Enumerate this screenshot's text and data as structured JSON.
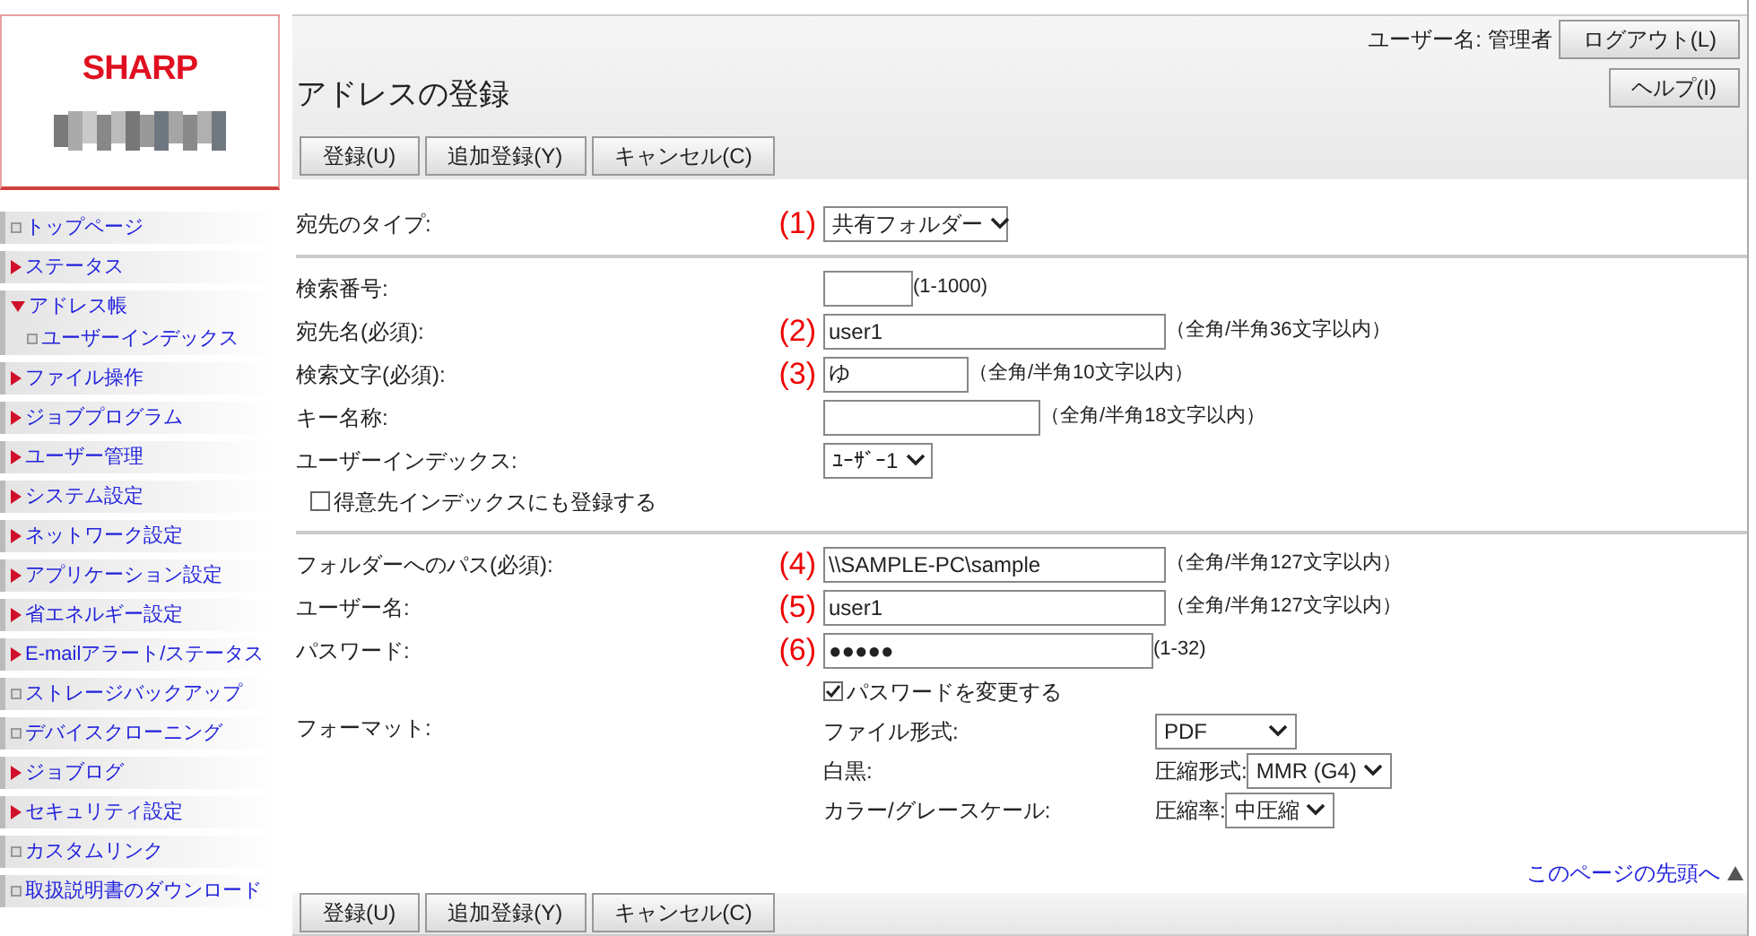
{
  "logo": {
    "brand": "SHARP"
  },
  "header": {
    "user_label": "ユーザー名: 管理者",
    "buttons": [
      "ログアウト(L)",
      "ヘルプ(I)"
    ],
    "title": "アドレスの登録"
  },
  "action_buttons": [
    "登録(U)",
    "追加登録(Y)",
    "キャンセル(C)"
  ],
  "sidebar": {
    "items": [
      {
        "label": "トップページ",
        "kind": "page"
      },
      {
        "label": "ステータス",
        "kind": "section",
        "expanded": false
      },
      {
        "label": "アドレス帳",
        "kind": "section",
        "expanded": true,
        "children": [
          {
            "label": "ユーザーインデックス",
            "kind": "page"
          }
        ]
      },
      {
        "label": "ファイル操作",
        "kind": "section",
        "expanded": false
      },
      {
        "label": "ジョブプログラム",
        "kind": "section",
        "expanded": false
      },
      {
        "label": "ユーザー管理",
        "kind": "section",
        "expanded": false
      },
      {
        "label": "システム設定",
        "kind": "section",
        "expanded": false
      },
      {
        "label": "ネットワーク設定",
        "kind": "section",
        "expanded": false
      },
      {
        "label": "アプリケーション設定",
        "kind": "section",
        "expanded": false
      },
      {
        "label": "省エネルギー設定",
        "kind": "section",
        "expanded": false
      },
      {
        "label": "E-mailアラート/ステータス",
        "kind": "section",
        "expanded": false
      },
      {
        "label": "ストレージバックアップ",
        "kind": "page"
      },
      {
        "label": "デバイスクローニング",
        "kind": "page"
      },
      {
        "label": "ジョブログ",
        "kind": "section",
        "expanded": false
      },
      {
        "label": "セキュリティ設定",
        "kind": "section",
        "expanded": false
      },
      {
        "label": "カスタムリンク",
        "kind": "page"
      },
      {
        "label": "取扱説明書のダウンロード",
        "kind": "page"
      }
    ]
  },
  "form": {
    "sections": [
      {
        "rows": [
          {
            "kind": "select",
            "label": "宛先のタイプ:",
            "marker": "(1)",
            "value": "共有フォルダー"
          }
        ]
      },
      {
        "rows": [
          {
            "kind": "text",
            "label": "検索番号:",
            "hint": "(1-1000)"
          },
          {
            "kind": "text",
            "label": "宛先名(必須):",
            "marker": "(2)",
            "value": "user1",
            "hint": "（全角/半角36文字以内）"
          },
          {
            "kind": "text",
            "label": "検索文字(必須):",
            "marker": "(3)",
            "value": "ゆ",
            "hint": "（全角/半角10文字以内）"
          },
          {
            "kind": "text",
            "label": "キー名称:",
            "hint": "（全角/半角18文字以内）"
          },
          {
            "kind": "select",
            "label": "ユーザーインデックス:",
            "value": "ﾕｰｻﾞｰ1"
          },
          {
            "kind": "checkbox",
            "label": "得意先インデックスにも登録する",
            "checked": false
          }
        ]
      },
      {
        "rows": [
          {
            "kind": "text",
            "label": "フォルダーへのパス(必須):",
            "marker": "(4)",
            "value": "\\\\SAMPLE-PC\\sample",
            "hint": "（全角/半角127文字以内）"
          },
          {
            "kind": "text",
            "label": "ユーザー名:",
            "marker": "(5)",
            "value": "user1",
            "hint": "（全角/半角127文字以内）"
          },
          {
            "kind": "text",
            "label": "パスワード:",
            "marker": "(6)",
            "value": "●●●●●",
            "hint": "(1-32)"
          },
          {
            "kind": "checkbox",
            "label": "パスワードを変更する",
            "checked": true
          },
          {
            "kind": "format",
            "label": "フォーマット:",
            "items": [
              {
                "label": "ファイル形式:",
                "value": "PDF"
              },
              {
                "label": "白黒:",
                "select_label": "圧縮形式:",
                "value": "MMR (G4)"
              },
              {
                "label": "カラー/グレースケール:",
                "select_label": "圧縮率:",
                "value": "中圧縮"
              }
            ]
          }
        ]
      }
    ]
  },
  "top_link": "このページの先頭へ",
  "bottom_buttons": [
    "登録(U)",
    "追加登録(Y)",
    "キャンセル(C)"
  ]
}
